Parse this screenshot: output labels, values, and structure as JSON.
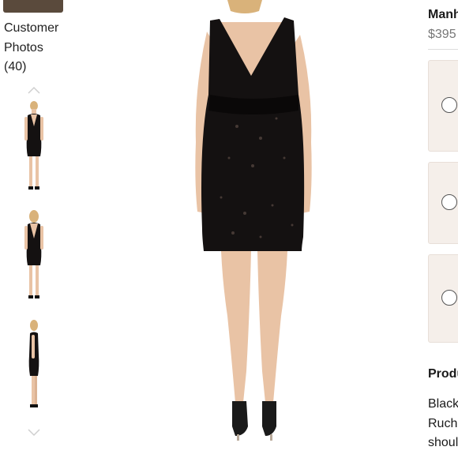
{
  "customer_photos": {
    "label_line1": "Customer",
    "label_line2": "Photos",
    "count": "(40)"
  },
  "thumbnails": [
    {
      "view": "front"
    },
    {
      "view": "back"
    },
    {
      "view": "side"
    }
  ],
  "product": {
    "name": "Manh",
    "price": "$395"
  },
  "options": [
    {
      "selected": false
    },
    {
      "selected": false
    },
    {
      "selected": false
    }
  ],
  "details": {
    "title": "Produ",
    "lines": [
      "Black",
      "Ruchi",
      "shoul"
    ]
  },
  "colors": {
    "dress": "#141111",
    "skin": "#e9c3a5",
    "hair": "#d9b27a",
    "card_bg": "#f5efea"
  }
}
